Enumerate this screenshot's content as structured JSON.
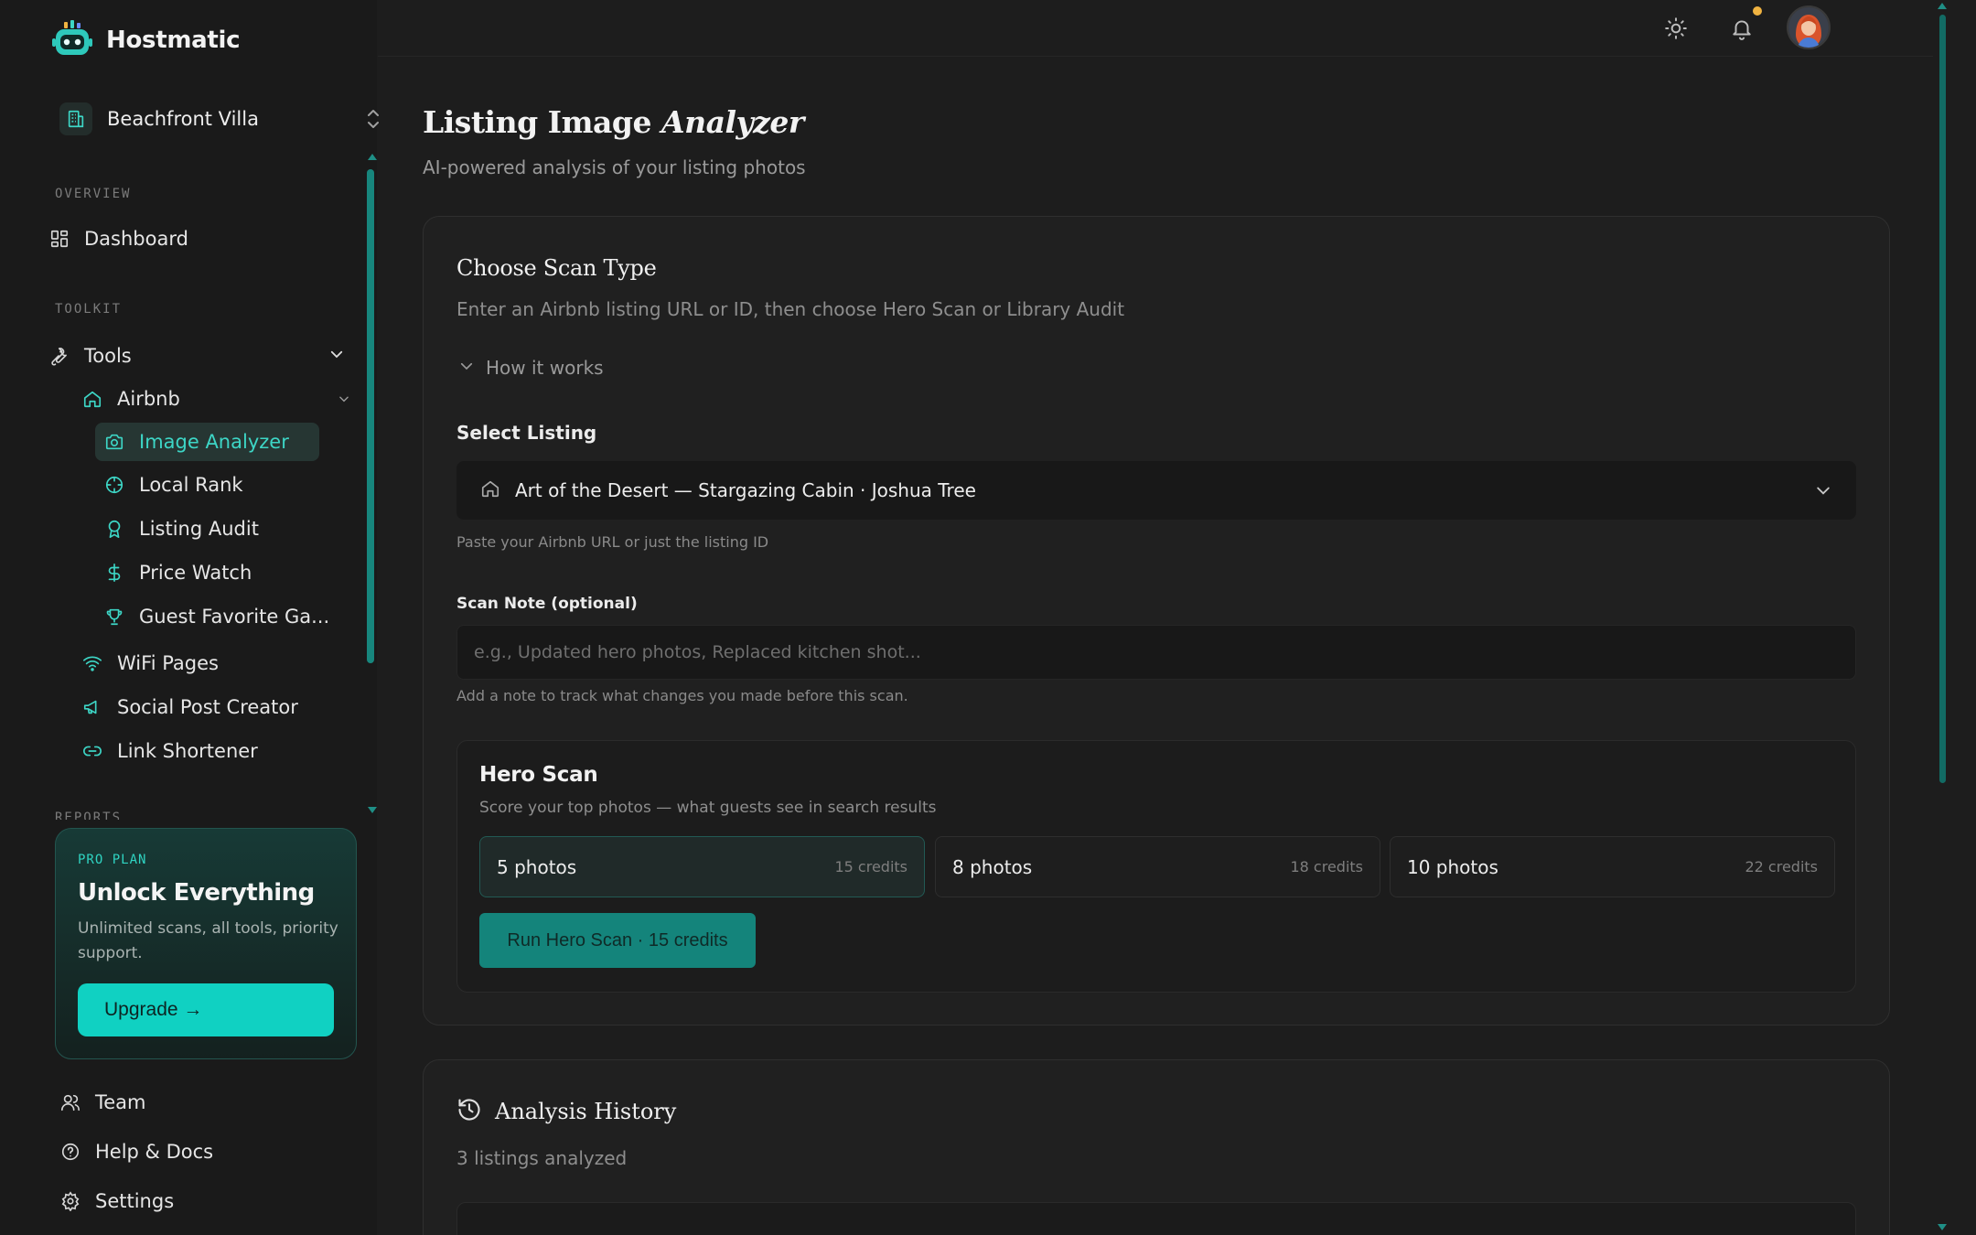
{
  "brand": {
    "name": "Hostmatic"
  },
  "property_switcher": {
    "name": "Beachfront Villa"
  },
  "sidebar": {
    "sections": {
      "overview": "OVERVIEW",
      "toolkit": "TOOLKIT",
      "reports": "REPORTS"
    },
    "dashboard": "Dashboard",
    "tools": "Tools",
    "airbnb": "Airbnb",
    "airbnb_items": [
      "Image Analyzer",
      "Local Rank",
      "Listing Audit",
      "Price Watch",
      "Guest Favorite Ga..."
    ],
    "other_tools": [
      "WiFi Pages",
      "Social Post Creator",
      "Link Shortener"
    ],
    "footer": [
      "Team",
      "Help & Docs",
      "Settings"
    ]
  },
  "pro_card": {
    "tag": "PRO PLAN",
    "title": "Unlock Everything",
    "description": "Unlimited scans, all tools, priority support.",
    "button": "Upgrade →"
  },
  "page": {
    "title_plain": "Listing Image",
    "title_italic": "Analyzer",
    "subtitle": "AI-powered analysis of your listing photos"
  },
  "scan_card": {
    "title": "Choose Scan Type",
    "subtitle": "Enter an Airbnb listing URL or ID, then choose Hero Scan or Library Audit",
    "how_it_works": "How it works",
    "select_label": "Select Listing",
    "selected_listing": "Art of the Desert — Stargazing Cabin · Joshua Tree",
    "select_help": "Paste your Airbnb URL or just the listing ID",
    "note_label": "Scan Note (optional)",
    "note_placeholder": "e.g., Updated hero photos, Replaced kitchen shot...",
    "note_value": "",
    "note_help": "Add a note to track what changes you made before this scan."
  },
  "hero_scan": {
    "title": "Hero Scan",
    "subtitle": "Score your top photos — what guests see in search results",
    "options": [
      {
        "photos": "5 photos",
        "credits": "15 credits",
        "selected": true
      },
      {
        "photos": "8 photos",
        "credits": "18 credits",
        "selected": false
      },
      {
        "photos": "10 photos",
        "credits": "22 credits",
        "selected": false
      }
    ],
    "run_button": "Run Hero Scan · 15 credits"
  },
  "history": {
    "title": "Analysis History",
    "subtitle": "3 listings analyzed"
  },
  "colors": {
    "accent": "#10d1c2",
    "accent_dark": "#14847b",
    "background": "#1d1d1d",
    "card": "#202020",
    "notification_dot": "#f0b341"
  }
}
